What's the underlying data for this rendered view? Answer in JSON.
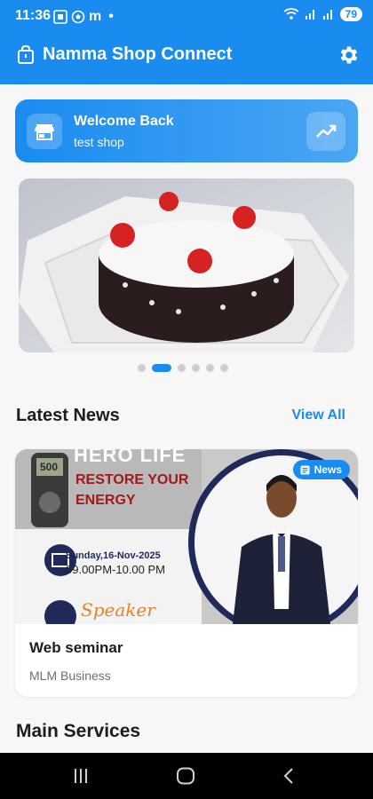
{
  "status_bar": {
    "time": "11:36",
    "left_icons": "m",
    "battery": "79"
  },
  "app_bar": {
    "title": "Namma Shop Connect"
  },
  "welcome": {
    "title": "Welcome Back",
    "shop_name": "test shop"
  },
  "carousel": {
    "slide_count": 6,
    "active_index": 1
  },
  "latest_news": {
    "heading": "Latest News",
    "view_all": "View All",
    "card": {
      "badge": "News",
      "title": "Web seminar",
      "category": "MLM Business",
      "poster": {
        "banner_text": "HERO LIFE",
        "headline_line1": "RESTORE YOUR",
        "headline_line2": "ENERGY",
        "date": "Sunday,16-Nov-2025",
        "time": "09.00PM-10.00 PM",
        "speaker_label": "Speaker",
        "device_display": "500"
      }
    }
  },
  "main_services": {
    "heading": "Main Services"
  },
  "colors": {
    "primary": "#1a8cf0",
    "text": "#1d1d1d",
    "muted": "#6e6e6e"
  }
}
